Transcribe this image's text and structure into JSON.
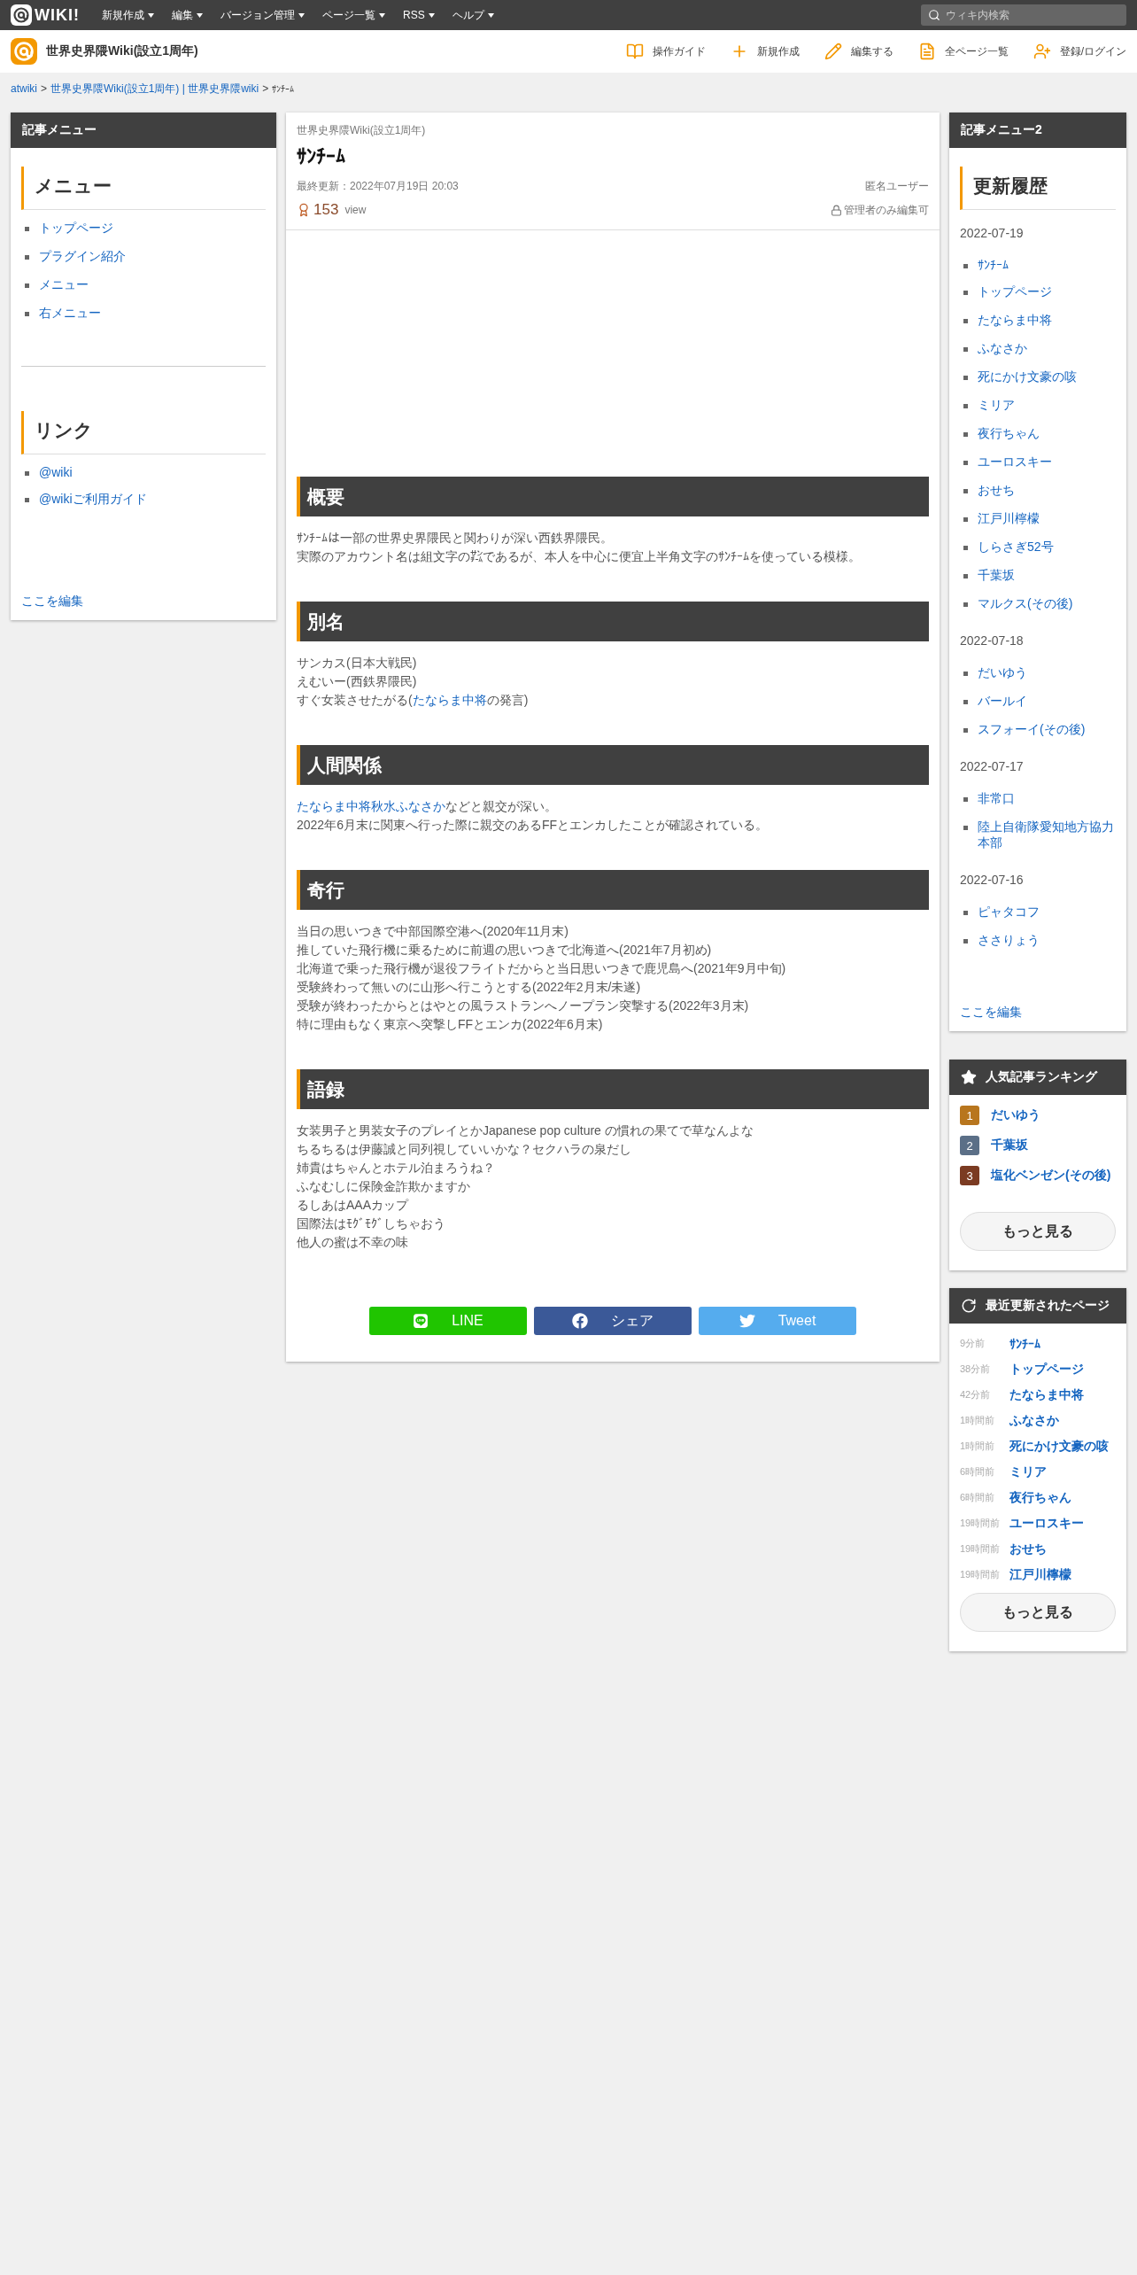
{
  "topbar": {
    "logo_text": "WIKI!",
    "menus": [
      {
        "label": "新規作成"
      },
      {
        "label": "編集"
      },
      {
        "label": "バージョン管理"
      },
      {
        "label": "ページ一覧"
      },
      {
        "label": "RSS"
      },
      {
        "label": "ヘルプ"
      }
    ],
    "search": {
      "placeholder": "ウィキ内検索"
    }
  },
  "header": {
    "site_name": "世界史界隈Wiki(設立1周年)",
    "actions": [
      {
        "label": "操作ガイド",
        "kind": "guide"
      },
      {
        "label": "新規作成",
        "kind": "new"
      },
      {
        "label": "編集する",
        "kind": "edit"
      },
      {
        "label": "全ページ一覧",
        "kind": "list"
      },
      {
        "label": "登録/ログイン",
        "kind": "login"
      }
    ]
  },
  "breadcrumb": [
    {
      "text": "atwiki",
      "kind": "link"
    },
    {
      "text": ">",
      "kind": "sep"
    },
    {
      "text": "世界史界隈Wiki(設立1周年) | 世界史界隈wiki",
      "kind": "link"
    },
    {
      "text": ">",
      "kind": "sep"
    },
    {
      "text": "ｻﾝﾁｰﾑ",
      "kind": "current"
    }
  ],
  "left_menu": {
    "title": "記事メニュー",
    "blocks": [
      {
        "heading": "メニュー",
        "items": [
          "トップページ",
          "プラグイン紹介",
          "メニュー",
          "右メニュー"
        ]
      },
      {
        "heading": "リンク",
        "items": [
          "@wiki",
          "@wikiご利用ガイド"
        ]
      }
    ],
    "edit_link": "ここを編集"
  },
  "article": {
    "site_label": "世界史界隈Wiki(設立1周年)",
    "title": "ｻﾝﾁｰﾑ",
    "updated": "最終更新：2022年07月19日 20:03",
    "author": "匿名ユーザー",
    "views": "153",
    "views_unit": "view",
    "permission": "管理者のみ編集可",
    "sections": [
      {
        "heading": "概要",
        "lines": [
          [
            {
              "kind": "text",
              "text": "ｻﾝﾁｰﾑは一部の世界史界隈民と関わりが深い西鉄界隈民。"
            }
          ],
          [
            {
              "kind": "text",
              "text": "実際のアカウント名は組文字の㌠であるが、本人を中心に便宜上半角文字のｻﾝﾁｰﾑを使っている模様。"
            }
          ]
        ]
      },
      {
        "heading": "別名",
        "lines": [
          [
            {
              "kind": "text",
              "text": "サンカス(日本大戦民)"
            }
          ],
          [
            {
              "kind": "text",
              "text": "えむいー(西鉄界隈民)"
            }
          ],
          [
            {
              "kind": "text",
              "text": "すぐ女装させたがる("
            },
            {
              "kind": "link",
              "text": "たならま中将"
            },
            {
              "kind": "text",
              "text": "の発言)"
            }
          ]
        ]
      },
      {
        "heading": "人間関係",
        "lines": [
          [
            {
              "kind": "link",
              "text": "たならま中将"
            },
            {
              "kind": "link",
              "text": "秋水"
            },
            {
              "kind": "link",
              "text": "ふなさか"
            },
            {
              "kind": "text",
              "text": "などと親交が深い。"
            }
          ],
          [
            {
              "kind": "text",
              "text": "2022年6月末に関東へ行った際に親交のあるFFとエンカしたことが確認されている。"
            }
          ]
        ]
      },
      {
        "heading": "奇行",
        "lines": [
          [
            {
              "kind": "text",
              "text": "当日の思いつきで中部国際空港へ(2020年11月末)"
            }
          ],
          [
            {
              "kind": "text",
              "text": "推していた飛行機に乗るために前週の思いつきで北海道へ(2021年7月初め)"
            }
          ],
          [
            {
              "kind": "text",
              "text": "北海道で乗った飛行機が退役フライトだからと当日思いつきで鹿児島へ(2021年9月中旬)"
            }
          ],
          [
            {
              "kind": "text",
              "text": "受験終わって無いのに山形へ行こうとする(2022年2月末/未遂)"
            }
          ],
          [
            {
              "kind": "text",
              "text": "受験が終わったからとはやとの風ラストランへノープラン突撃する(2022年3月末)"
            }
          ],
          [
            {
              "kind": "text",
              "text": "特に理由もなく東京へ突撃しFFとエンカ(2022年6月末)"
            }
          ]
        ]
      },
      {
        "heading": "語録",
        "lines": [
          [
            {
              "kind": "text",
              "text": "女装男子と男装女子のプレイとかJapanese pop culture の慣れの果てで草なんよな"
            }
          ],
          [
            {
              "kind": "text",
              "text": "ちるちるは伊藤誠と同列視していいかな？セクハラの泉だし"
            }
          ],
          [
            {
              "kind": "text",
              "text": "姉貴はちゃんとホテル泊まろうね？"
            }
          ],
          [
            {
              "kind": "text",
              "text": "ふなむしに保険金詐欺かますか"
            }
          ],
          [
            {
              "kind": "text",
              "text": "るしあはAAAカップ"
            }
          ],
          [
            {
              "kind": "text",
              "text": "国際法はﾓｸﾞﾓｸﾞしちゃおう"
            }
          ],
          [
            {
              "kind": "text",
              "text": "他人の蜜は不幸の味"
            }
          ]
        ]
      }
    ],
    "share": [
      {
        "label": "LINE",
        "kind": "line"
      },
      {
        "label": "シェア",
        "kind": "facebook"
      },
      {
        "label": "Tweet",
        "kind": "twitter"
      }
    ]
  },
  "right_menu": {
    "title": "記事メニュー2",
    "heading": "更新履歴",
    "groups": [
      {
        "date": "2022-07-19",
        "items": [
          "ｻﾝﾁｰﾑ",
          "トップページ",
          "たならま中将",
          "ふなさか",
          "死にかけ文豪の咳",
          "ミリア",
          "夜行ちゃん",
          "ユーロスキー",
          "おせち",
          "江戸川檸檬",
          "しらさぎ52号",
          "千葉坂",
          "マルクス(その後)"
        ]
      },
      {
        "date": "2022-07-18",
        "items": [
          "だいゆう",
          "バールイ",
          "スフォーイ(その後)"
        ]
      },
      {
        "date": "2022-07-17",
        "items": [
          "非常口",
          "陸上自衛隊愛知地方協力本部"
        ]
      },
      {
        "date": "2022-07-16",
        "items": [
          "ピャタコフ",
          "ささりょう"
        ]
      }
    ],
    "edit_link": "ここを編集"
  },
  "ranking": {
    "title": "人気記事ランキング",
    "items": [
      {
        "rank": "1",
        "label": "だいゆう",
        "color": "#b8761e"
      },
      {
        "rank": "2",
        "label": "千葉坂",
        "color": "#5b6f87"
      },
      {
        "rank": "3",
        "label": "塩化ベンゼン(その後)",
        "color": "#7b3b22"
      }
    ],
    "more": "もっと見る"
  },
  "recent": {
    "title": "最近更新されたページ",
    "items": [
      {
        "time": "9分前",
        "label": "ｻﾝﾁｰﾑ"
      },
      {
        "time": "38分前",
        "label": "トップページ"
      },
      {
        "time": "42分前",
        "label": "たならま中将"
      },
      {
        "time": "1時間前",
        "label": "ふなさか"
      },
      {
        "time": "1時間前",
        "label": "死にかけ文豪の咳"
      },
      {
        "time": "6時間前",
        "label": "ミリア"
      },
      {
        "time": "6時間前",
        "label": "夜行ちゃん"
      },
      {
        "time": "19時間前",
        "label": "ユーロスキー"
      },
      {
        "time": "19時間前",
        "label": "おせち"
      },
      {
        "time": "19時間前",
        "label": "江戸川檸檬"
      }
    ],
    "more": "もっと見る"
  }
}
